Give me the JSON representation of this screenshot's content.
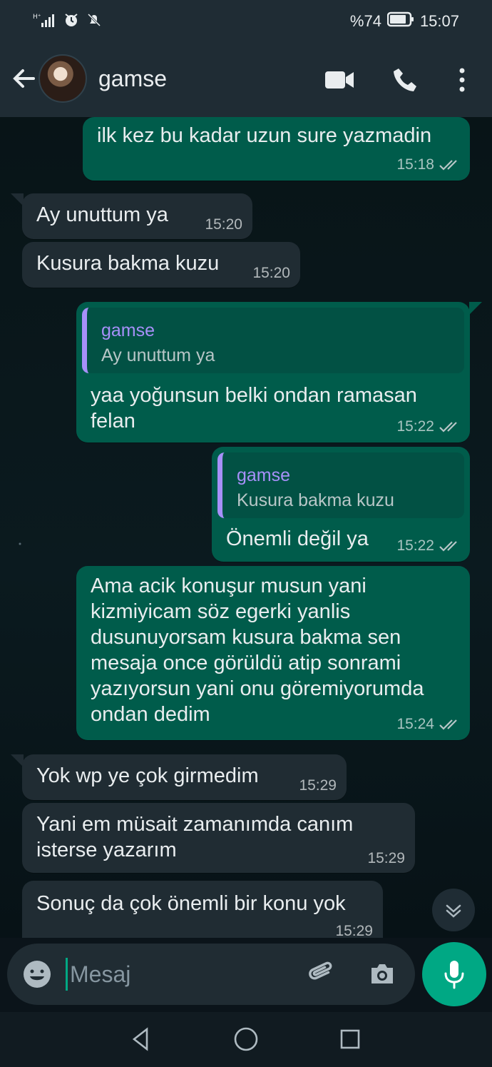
{
  "status_bar": {
    "left_icons": [
      "network-signal-icon",
      "alarm-icon",
      "mute-icon"
    ],
    "battery_percent": "%74",
    "time": "15:07"
  },
  "header": {
    "contact_name": "gamse",
    "actions": [
      "video-call-icon",
      "voice-call-icon",
      "more-options-icon"
    ]
  },
  "messages": [
    {
      "direction": "out",
      "text": "ilk kez bu kadar uzun sure yazmadin",
      "time": "15:18",
      "status": "read"
    },
    {
      "direction": "in",
      "text": "Ay unuttum ya",
      "time": "15:20"
    },
    {
      "direction": "in",
      "text": "Kusura bakma kuzu",
      "time": "15:20"
    },
    {
      "direction": "out",
      "quote": {
        "name": "gamse",
        "text": "Ay unuttum ya"
      },
      "lines": [
        "yaa yoğunsun belki ondan ramasan",
        "felan"
      ],
      "time": "15:22",
      "status": "read"
    },
    {
      "direction": "out",
      "quote": {
        "name": "gamse",
        "text": "Kusura bakma kuzu"
      },
      "text": "Önemli değil ya",
      "time": "15:22",
      "status": "read"
    },
    {
      "direction": "out",
      "lines": [
        "Ama acik konuşur musun yani",
        "kizmiyicam söz egerki yanlis",
        "dusunuyorsam kusura bakma sen",
        "mesaja once görüldü atip sonrami",
        "yazıyorsun yani onu göremiyorumda",
        "ondan dedim"
      ],
      "time": "15:24",
      "status": "read"
    },
    {
      "direction": "in",
      "text": "Yok wp ye çok girmedim",
      "time": "15:29"
    },
    {
      "direction": "in",
      "lines": [
        "Yani em müsait zamanımda canım",
        "isterse yazarım"
      ],
      "time": "15:29"
    },
    {
      "direction": "in",
      "text": "Sonuç da çok önemli bir konu yok",
      "time": "15:29"
    }
  ],
  "composer": {
    "placeholder": "Mesaj",
    "icons": [
      "emoji-icon",
      "attach-icon",
      "camera-icon",
      "microphone-icon"
    ]
  },
  "navigation": [
    "back-nav-icon",
    "home-nav-icon",
    "recent-apps-icon"
  ],
  "colors": {
    "background": "#0b141a",
    "header": "#1f2c34",
    "incoming_bubble": "#202c33",
    "outgoing_bubble": "#005c4b",
    "accent": "#00a884",
    "quote_accent": "#a790f9"
  }
}
